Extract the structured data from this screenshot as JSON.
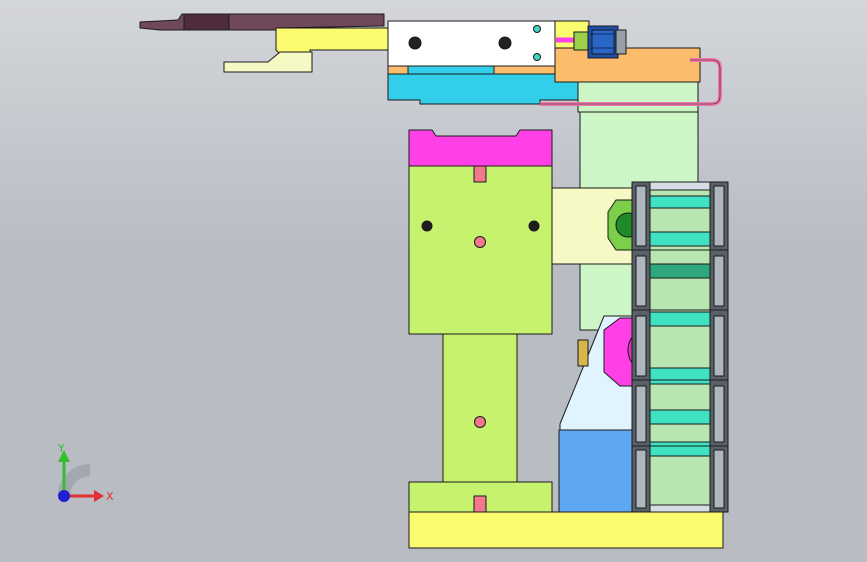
{
  "viewport": {
    "background_top": "#d4d6da",
    "background_bottom": "#b8bcc3"
  },
  "palette": {
    "lime": "#c6f26e",
    "magenta": "#ff40e6",
    "yellow": "#fbfb70",
    "cyan": "#33cfea",
    "orange": "#fbbc6c",
    "pale_yellow": "#f7f9c4",
    "light_green": "#cdf6c6",
    "blue": "#5ea8f2",
    "chain_teal": "#3fe3c4",
    "dark_plum": "#6f485c",
    "pink": "#f077ae",
    "outline": "#1a1a1a"
  },
  "triad": {
    "y_label": "Y",
    "x_label": "X",
    "y_color": "#30c030",
    "x_color": "#e03030",
    "z_color": "#2020d0"
  }
}
